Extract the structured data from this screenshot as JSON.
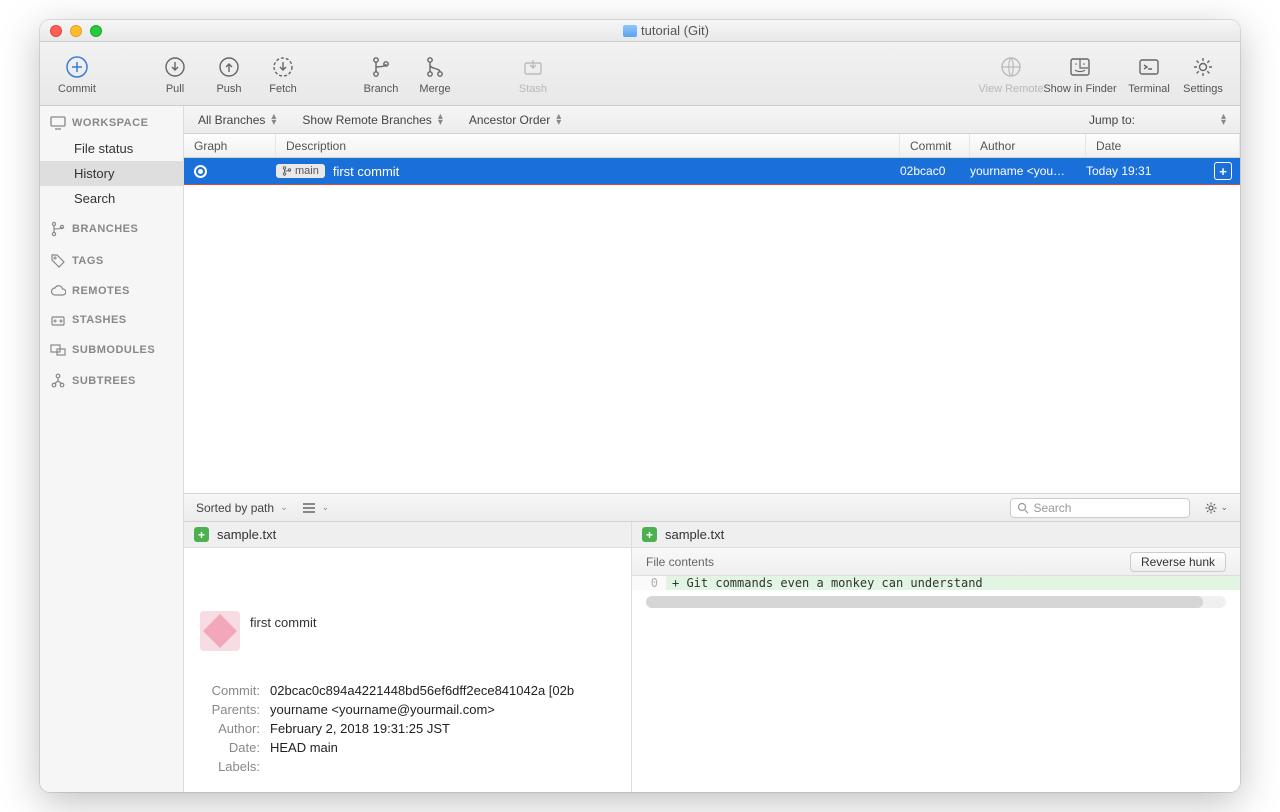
{
  "titlebar": {
    "title": "tutorial (Git)"
  },
  "toolbar": {
    "commit": "Commit",
    "pull": "Pull",
    "push": "Push",
    "fetch": "Fetch",
    "branch": "Branch",
    "merge": "Merge",
    "stash": "Stash",
    "viewRemote": "View Remote",
    "showInFinder": "Show in Finder",
    "terminal": "Terminal",
    "settings": "Settings"
  },
  "sidebar": {
    "sections": {
      "workspace": "WORKSPACE",
      "branches": "BRANCHES",
      "tags": "TAGS",
      "remotes": "REMOTES",
      "stashes": "STASHES",
      "submodules": "SUBMODULES",
      "subtrees": "SUBTREES"
    },
    "workspaceItems": {
      "fileStatus": "File status",
      "history": "History",
      "search": "Search"
    }
  },
  "filterbar": {
    "allBranches": "All Branches",
    "showRemote": "Show Remote Branches",
    "ancestorOrder": "Ancestor Order",
    "jumpTo": "Jump to:"
  },
  "columns": {
    "graph": "Graph",
    "description": "Description",
    "commit": "Commit",
    "author": "Author",
    "date": "Date"
  },
  "commits": [
    {
      "branch": "main",
      "description": "first commit",
      "hash": "02bcac0",
      "author": "yourname <you…",
      "date": "Today 19:31"
    }
  ],
  "detailBar": {
    "sorted": "Sorted by path",
    "searchPlaceholder": "Search"
  },
  "files": {
    "left": "sample.txt",
    "right": "sample.txt"
  },
  "commitMeta": {
    "title": "first commit",
    "labels": {
      "commit": "Commit:",
      "parents": "Parents:",
      "author": "Author:",
      "date": "Date:",
      "lbl": "Labels:"
    },
    "values": {
      "commit": "02bcac0c894a4221448bd56ef6dff2ece841042a [02b",
      "parents": "yourname <yourname@yourmail.com>",
      "author": "February 2, 2018 19:31:25 JST",
      "date": "HEAD main",
      "lbl": ""
    }
  },
  "diff": {
    "header": "File contents",
    "reverse": "Reverse hunk",
    "lineNum": "0",
    "lineText": "+ Git commands even a monkey can understand"
  }
}
